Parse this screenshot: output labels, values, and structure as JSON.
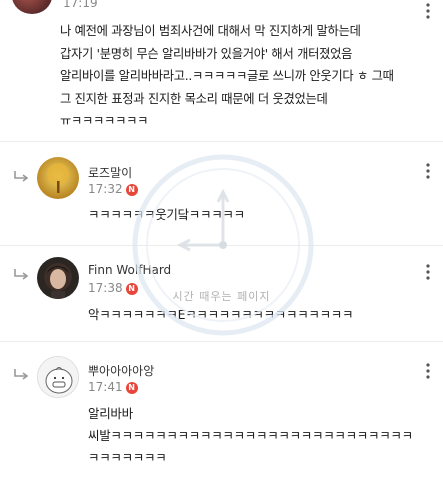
{
  "top_post": {
    "time": "17:19",
    "text": "나 예전에 과장님이 범죄사건에 대해서 막 진지하게 말하는데\n갑자기 '분명히 무슨 알리바바가 있을거야' 해서 개터졌었음\n알리바이를 알리바바라고..ㅋㅋㅋㅋㅋ글로 쓰니까 안웃기다 ㅎ 그때\n그 진지한 표정과 진지한 목소리 때문에 더 웃겼었는데\nㅠㅋㅋㅋㅋㅋㅋㅋ"
  },
  "replies": [
    {
      "name": "로즈말이",
      "time": "17:32",
      "badge": "N",
      "text": "ㅋㅋㅋㅋㅋㅋ웃기닼ㅋㅋㅋㅋㅋ"
    },
    {
      "name": "Finn WolfHard",
      "time": "17:38",
      "badge": "N",
      "text": "악ㅋㅋㅋㅋㅋㅋㅋEㅋㅋㅋㅋㅋㅋㅋㅋㅋㅋㅋㅋㅋㅋㅋ"
    },
    {
      "name": "뿌아아아아앙",
      "time": "17:41",
      "badge": "N",
      "text": "알리바바\n씨발ㅋㅋㅋㅋㅋㅋㅋㅋㅋㅋㅋㅋㅋㅋㅋㅋㅋㅋㅋㅋㅋㅋㅋㅋㅋㅋㅋ\nㅋㅋㅋㅋㅋㅋㅋ"
    }
  ],
  "watermark": {
    "text": "시간 때우는 페이지"
  },
  "icons": {
    "more": "more-vertical-icon",
    "reply": "reply-arrow-icon"
  }
}
